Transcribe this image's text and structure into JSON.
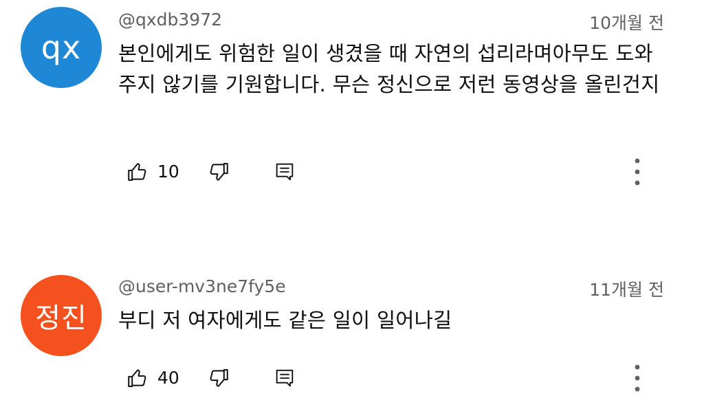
{
  "comments": [
    {
      "avatar_text": "qx",
      "avatar_color": "#1e88d6",
      "handle": "@qxdb3972",
      "time": "10개월 전",
      "text": "본인에게도 위험한 일이 생겼을 때 자연의 섭리라며아무도 도와주지 않기를 기원합니다. 무슨 정신으로 저런 동영상을 올린건지",
      "likes": "10"
    },
    {
      "avatar_text": "정진",
      "avatar_color": "#f4511e",
      "handle": "@user-mv3ne7fy5e",
      "time": "11개월 전",
      "text": "부디 저 여자에게도 같은 일이 일어나길",
      "likes": "40"
    }
  ],
  "icons": {
    "like": "thumbs-up-icon",
    "dislike": "thumbs-down-icon",
    "reply": "reply-comment-icon",
    "more": "more-vert-icon"
  }
}
